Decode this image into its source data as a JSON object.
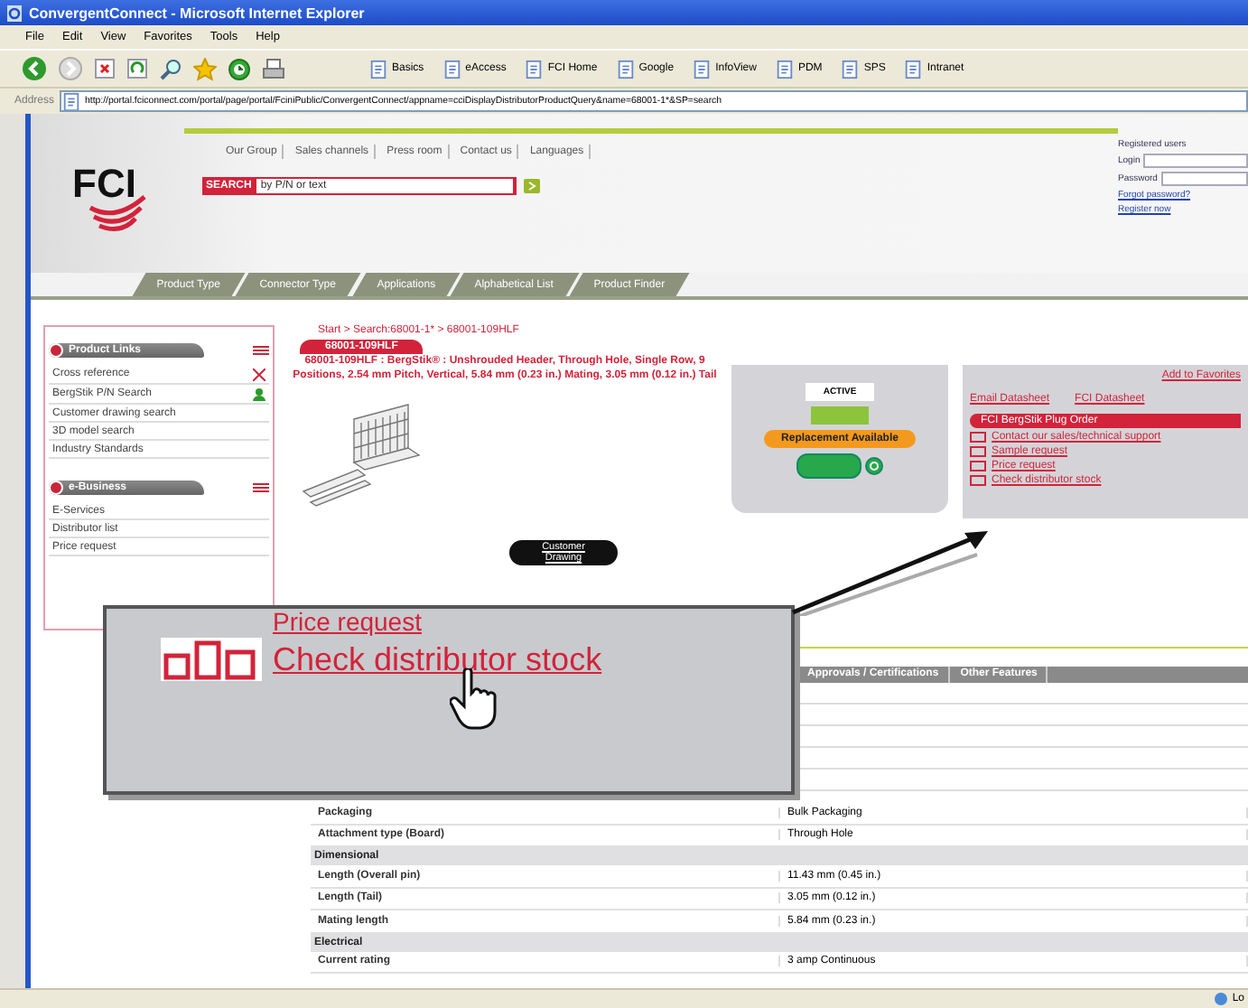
{
  "window": {
    "title": "ConvergentConnect - Microsoft Internet Explorer"
  },
  "menu": [
    "File",
    "Edit",
    "View",
    "Favorites",
    "Tools",
    "Help"
  ],
  "links": [
    "Basics",
    "eAccess",
    "FCI Home",
    "Google",
    "InfoView",
    "PDM",
    "SPS",
    "Intranet"
  ],
  "address": {
    "label": "Address",
    "url": "http://portal.fciconnect.com/portal/page/portal/FciniPublic/ConvergentConnect/appname=cciDisplayDistributorProductQuery&name=68001-1*&SP=search"
  },
  "header": {
    "logo": "FCI",
    "nav": [
      "Our Group",
      "Sales channels",
      "Press room",
      "Contact us",
      "Languages"
    ],
    "search": {
      "label": "SEARCH",
      "value": "by P/N or text"
    },
    "login": {
      "title": "Registered users",
      "fields": [
        "Login",
        "Password"
      ],
      "links": [
        "Forgot password?",
        "Register now"
      ]
    },
    "tabs": [
      {
        "label": "Product Type",
        "selected": false
      },
      {
        "label": "Connector Type",
        "selected": false
      },
      {
        "label": "Applications",
        "selected": false
      },
      {
        "label": "Alphabetical List",
        "selected": false
      },
      {
        "label": "Product Finder",
        "selected": false
      }
    ]
  },
  "sidebar": [
    {
      "title": "Product Links",
      "items": [
        "Cross reference",
        "BergStik P/N Search",
        "Customer drawing search",
        "3D model search",
        "Industry Standards"
      ]
    },
    {
      "title": "e-Business",
      "items": [
        "E-Services",
        "Distributor list",
        "Price request"
      ]
    }
  ],
  "product": {
    "breadcrumb": "Start > Search:68001-1* > 68001-109HLF",
    "part_tab": "68001-109HLF",
    "description": "68001-109HLF : BergStik® : Unshrouded Header, Through Hole, Single Row, 9 Positions, 2.54 mm Pitch, Vertical, 5.84 mm (0.23 in.) Mating, 3.05 mm (0.12 in.) Tail",
    "status": "ACTIVE",
    "replacement": "Replacement Available",
    "favorites": "Add to Favorites",
    "actions": [
      "Email Datasheet",
      "FCI Datasheet"
    ],
    "order_bar": "FCI BergStik Plug Order",
    "order_links": [
      "Contact our sales/technical support",
      "Sample request",
      "Price request",
      "Check distributor stock"
    ],
    "drawing_button": "Customer Drawing"
  },
  "table": {
    "tabs": [
      "Approvals / Certifications",
      "Other Features"
    ],
    "rows": [
      {
        "kind": "row",
        "label": "Packaging",
        "value": "Bulk Packaging"
      },
      {
        "kind": "row",
        "label": "Attachment type (Board)",
        "value": "Through Hole"
      },
      {
        "kind": "section",
        "label": "Dimensional"
      },
      {
        "kind": "row",
        "label": "Length (Overall pin)",
        "value": "11.43 mm (0.45 in.)"
      },
      {
        "kind": "row",
        "label": "Length (Tail)",
        "value": "3.05 mm (0.12 in.)"
      },
      {
        "kind": "row",
        "label": "Mating length",
        "value": "5.84 mm (0.23 in.)"
      },
      {
        "kind": "section",
        "label": "Electrical"
      },
      {
        "kind": "row",
        "label": "Current rating",
        "value": "3 amp Continuous"
      }
    ]
  },
  "callout": {
    "links": [
      "Price request",
      "Check distributor stock"
    ]
  },
  "status_bar": {
    "zone": "Lo"
  }
}
